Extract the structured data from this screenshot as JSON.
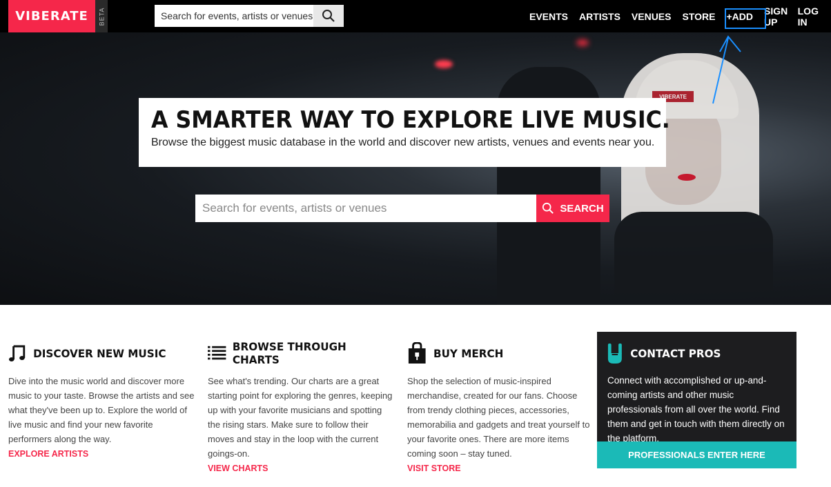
{
  "header": {
    "logo": "VIBERATE",
    "beta": "BETA",
    "search_placeholder": "Search for events, artists or venues",
    "nav": [
      "EVENTS",
      "ARTISTS",
      "VENUES",
      "STORE",
      "+ADD",
      "SIGN UP",
      "LOG IN"
    ]
  },
  "hero": {
    "headline": "A SMARTER WAY TO EXPLORE LIVE MUSIC.",
    "subline": "Browse the biggest music database in the world and discover new artists, venues and events near you.",
    "search_placeholder": "Search for events, artists or venues",
    "search_button": "SEARCH",
    "hat_label": "VIBERATE"
  },
  "sections": [
    {
      "title": "DISCOVER NEW MUSIC",
      "icon": "music-note-icon",
      "text": "Dive into the music world and discover more music to your taste. Browse the artists and see what they've been up to. Explore the world of live music and find your new favorite performers along the way.",
      "link": "EXPLORE ARTISTS"
    },
    {
      "title": "BROWSE THROUGH CHARTS",
      "icon": "list-icon",
      "text": "See what's trending. Our charts are a great starting point for exploring the genres, keeping up with your favorite musicians and spotting the rising stars. Make sure to follow their moves and stay in the loop with the current goings-on.",
      "link": "VIEW CHARTS"
    },
    {
      "title": "BUY MERCH",
      "icon": "shopping-bag-icon",
      "text": "Shop the selection of music-inspired merchandise, created for our fans. Choose from trendy clothing pieces, accessories, memorabilia and gadgets and treat yourself to your favorite ones. There are more items coming soon – stay tuned.",
      "link": "VISIT STORE"
    }
  ],
  "contact": {
    "title": "CONTACT PROS",
    "icon": "rock-hand-icon",
    "text": "Connect with accomplished or up-and-coming artists and other music professionals from all over the world. Find them and get in touch with them directly on the platform.",
    "button": "PROFESSIONALS ENTER HERE"
  },
  "colors": {
    "brand": "#f5274a",
    "teal": "#1bbab7",
    "annotation": "#1a8fff"
  }
}
